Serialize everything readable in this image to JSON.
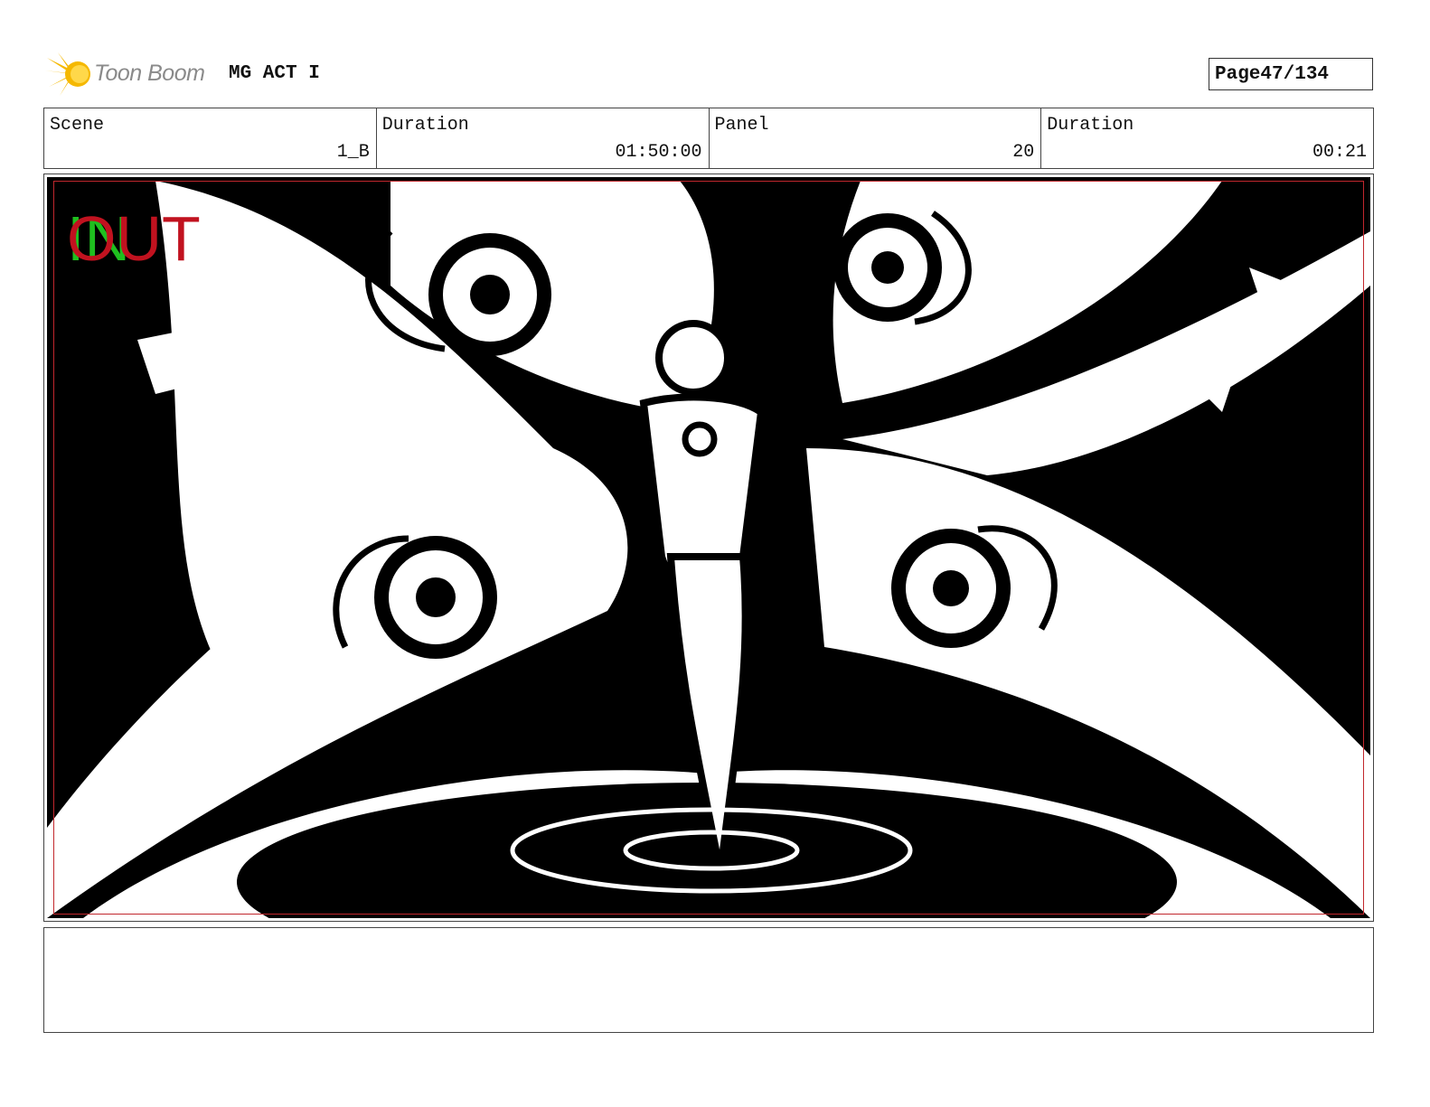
{
  "header": {
    "logo_text": "Toon Boom",
    "project_title": "MG ACT I",
    "page_label": "Page",
    "page_value": "47/134"
  },
  "info": {
    "scene_label": "Scene",
    "scene_value": "1_B",
    "scene_duration_label": "Duration",
    "scene_duration_value": "01:50:00",
    "panel_label": "Panel",
    "panel_value": "20",
    "panel_duration_label": "Duration",
    "panel_duration_value": "00:21"
  },
  "panel": {
    "in_mark": "IN",
    "out_mark": "OUT"
  },
  "colors": {
    "in_mark": "#1fbf1f",
    "out_mark": "#c1121f",
    "safe_frame": "#c1272d",
    "logo_flare": "#f5b800"
  },
  "notes": {
    "text": ""
  }
}
